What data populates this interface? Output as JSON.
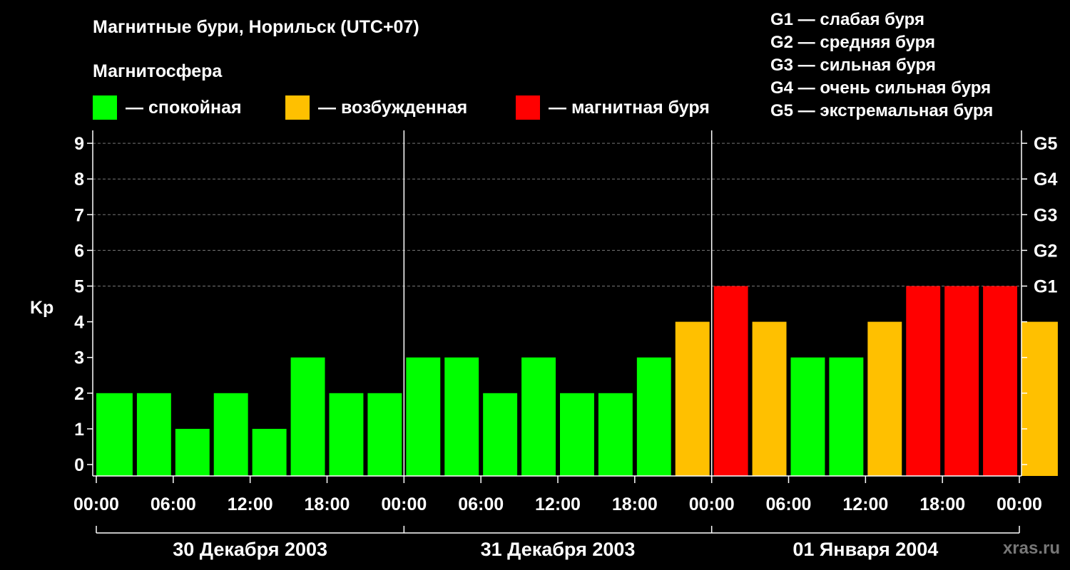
{
  "title": "Магнитные бури, Норильск (UTC+07)",
  "magnetosphere_label": "Магнитосфера",
  "legend": [
    {
      "color": "#00ff00",
      "label": "— спокойная"
    },
    {
      "color": "#ffc000",
      "label": "— возбужденная"
    },
    {
      "color": "#ff0000",
      "label": "— магнитная буря"
    }
  ],
  "g_legend": [
    "G1 — слабая буря",
    "G2 — средняя буря",
    "G3 — сильная буря",
    "G4 — очень сильная буря",
    "G5 — экстремальная буря"
  ],
  "watermark": "xras.ru",
  "chart_data": {
    "type": "bar",
    "ylabel": "Kp",
    "ylim": [
      0,
      9
    ],
    "y_ticks": [
      "0",
      "1",
      "2",
      "3",
      "4",
      "5",
      "6",
      "7",
      "8",
      "9"
    ],
    "right_ticks": [
      {
        "kp": 5,
        "label": "G1"
      },
      {
        "kp": 6,
        "label": "G2"
      },
      {
        "kp": 7,
        "label": "G3"
      },
      {
        "kp": 8,
        "label": "G4"
      },
      {
        "kp": 9,
        "label": "G5"
      }
    ],
    "x_tick_labels": [
      "00:00",
      "06:00",
      "12:00",
      "18:00",
      "00:00",
      "06:00",
      "12:00",
      "18:00",
      "00:00",
      "06:00",
      "12:00",
      "18:00",
      "00:00"
    ],
    "days": [
      "30 Декабря 2003",
      "31 Декабря 2003",
      "01 Января 2004"
    ],
    "grid": "dashed horizontal lines at Kp 5–9",
    "bin_hours": 3,
    "series": [
      {
        "values": [
          2,
          2,
          1,
          2,
          1,
          3,
          2,
          2,
          3,
          3,
          2,
          3,
          2,
          2,
          3,
          4,
          5,
          4,
          3,
          3,
          4,
          5,
          5,
          5,
          4
        ],
        "levels": [
          "quiet",
          "quiet",
          "quiet",
          "quiet",
          "quiet",
          "quiet",
          "quiet",
          "quiet",
          "quiet",
          "quiet",
          "quiet",
          "quiet",
          "quiet",
          "quiet",
          "quiet",
          "active",
          "storm",
          "active",
          "quiet",
          "quiet",
          "active",
          "storm",
          "storm",
          "storm",
          "active"
        ]
      }
    ],
    "level_colors": {
      "quiet": "#00ff00",
      "active": "#ffc000",
      "storm": "#ff0000"
    }
  }
}
